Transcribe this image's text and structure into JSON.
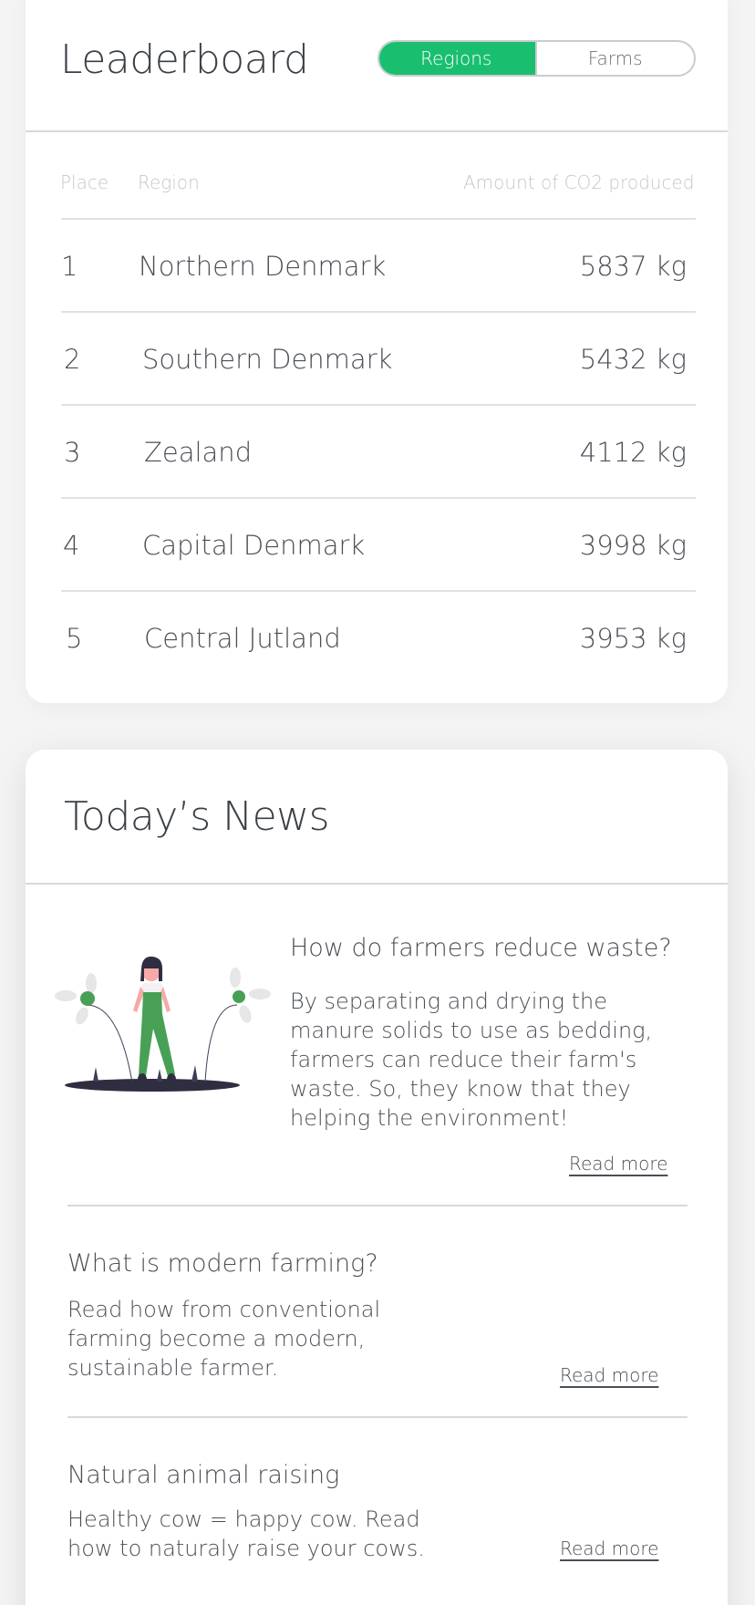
{
  "leaderboard": {
    "title": "Leaderboard",
    "toggle": {
      "regions_label": "Regions",
      "farms_label": "Farms",
      "active": "Regions"
    },
    "columns": {
      "place": "Place",
      "region": "Region",
      "amount": "Amount of CO2 produced"
    },
    "rows": [
      {
        "place": "1",
        "region": "Northern Denmark",
        "amount": "5837 kg"
      },
      {
        "place": "2",
        "region": "Southern Denmark",
        "amount": "5432 kg"
      },
      {
        "place": "3",
        "region": "Zealand",
        "amount": "4112 kg"
      },
      {
        "place": "4",
        "region": "Capital Denmark",
        "amount": "3998 kg"
      },
      {
        "place": "5",
        "region": "Central Jutland",
        "amount": "3953 kg"
      }
    ]
  },
  "news": {
    "title": "Today’s News",
    "items": [
      {
        "headline": "How do farmers reduce waste?",
        "body": "By separating and drying the manure solids to use as bedding, farmers can reduce their farm's waste. So, they know that they helping the environment!",
        "link": "Read more",
        "image_icon": "farmer-illustration"
      },
      {
        "headline": "What is modern farming?",
        "body": "Read how from conventional farming become a modern, sustainable farmer.",
        "link": "Read more"
      },
      {
        "headline": "Natural animal raising",
        "body": "Healthy cow = happy cow. Read how to naturaly raise your cows.",
        "link": "Read more"
      }
    ]
  },
  "colors": {
    "accent": "#19bf6f",
    "text": "#3a3f45",
    "muted": "#c4c7ca",
    "divider": "#d6d9dc"
  }
}
